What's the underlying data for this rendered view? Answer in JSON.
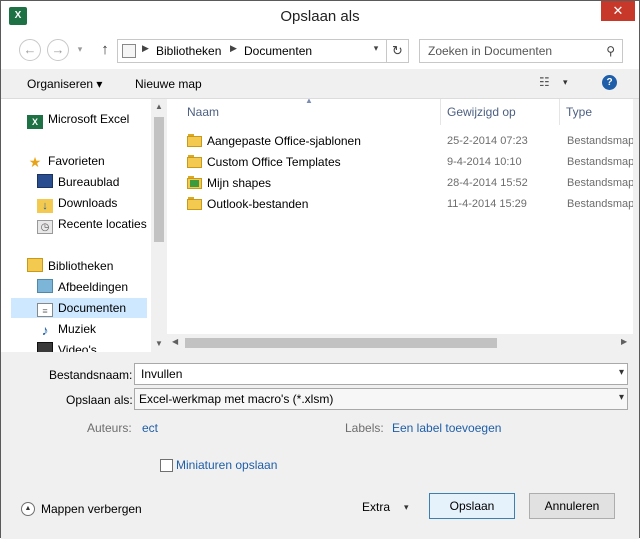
{
  "window": {
    "title": "Opslaan als",
    "app_icon": "X",
    "close": "✕"
  },
  "address": {
    "back": "←",
    "forward": "→",
    "up": "↑",
    "crumbs": [
      "Bibliotheken",
      "Documenten"
    ],
    "separator": "▶",
    "dropdown": "▾",
    "refresh": "↻"
  },
  "search": {
    "placeholder": "Zoeken in Documenten",
    "icon": "⚲"
  },
  "toolbar": {
    "organize": "Organiseren ▾",
    "new_folder": "Nieuwe map",
    "view_icon": "☷",
    "view_dropdown": "▾",
    "help": "?"
  },
  "nav": {
    "items": [
      {
        "label": "Microsoft Excel",
        "icon": "excel-icon"
      },
      {
        "label": "Favorieten",
        "icon": "star-icon"
      },
      {
        "label": "Bureaublad",
        "icon": "desktop-icon"
      },
      {
        "label": "Downloads",
        "icon": "downloads-icon"
      },
      {
        "label": "Recente locaties",
        "icon": "recent-places-icon"
      },
      {
        "label": "Bibliotheken",
        "icon": "libraries-icon"
      },
      {
        "label": "Afbeeldingen",
        "icon": "pictures-icon"
      },
      {
        "label": "Documenten",
        "icon": "documents-icon",
        "selected": true
      },
      {
        "label": "Muziek",
        "icon": "music-icon"
      },
      {
        "label": "Video's",
        "icon": "videos-icon"
      }
    ]
  },
  "columns": {
    "name": "Naam",
    "modified": "Gewijzigd op",
    "type": "Type"
  },
  "files": [
    {
      "name": "Aangepaste Office-sjablonen",
      "modified": "25-2-2014 07:23",
      "type": "Bestandsmap"
    },
    {
      "name": "Custom Office Templates",
      "modified": "9-4-2014 10:10",
      "type": "Bestandsmap"
    },
    {
      "name": "Mijn shapes",
      "modified": "28-4-2014 15:52",
      "type": "Bestandsmap"
    },
    {
      "name": "Outlook-bestanden",
      "modified": "11-4-2014 15:29",
      "type": "Bestandsmap"
    }
  ],
  "form": {
    "filename_label": "Bestandsnaam:",
    "filename_value": "Invullen",
    "savetype_label": "Opslaan als:",
    "savetype_value": "Excel-werkmap met macro's (*.xlsm)",
    "authors_label": "Auteurs:",
    "authors_value": "ect",
    "labels_label": "Labels:",
    "labels_value": "Een label toevoegen",
    "thumbnails_label": "Miniaturen opslaan"
  },
  "footer": {
    "hide_folders": "Mappen verbergen",
    "tools": "Extra",
    "tools_dropdown": "▾",
    "save": "Opslaan",
    "cancel": "Annuleren"
  }
}
